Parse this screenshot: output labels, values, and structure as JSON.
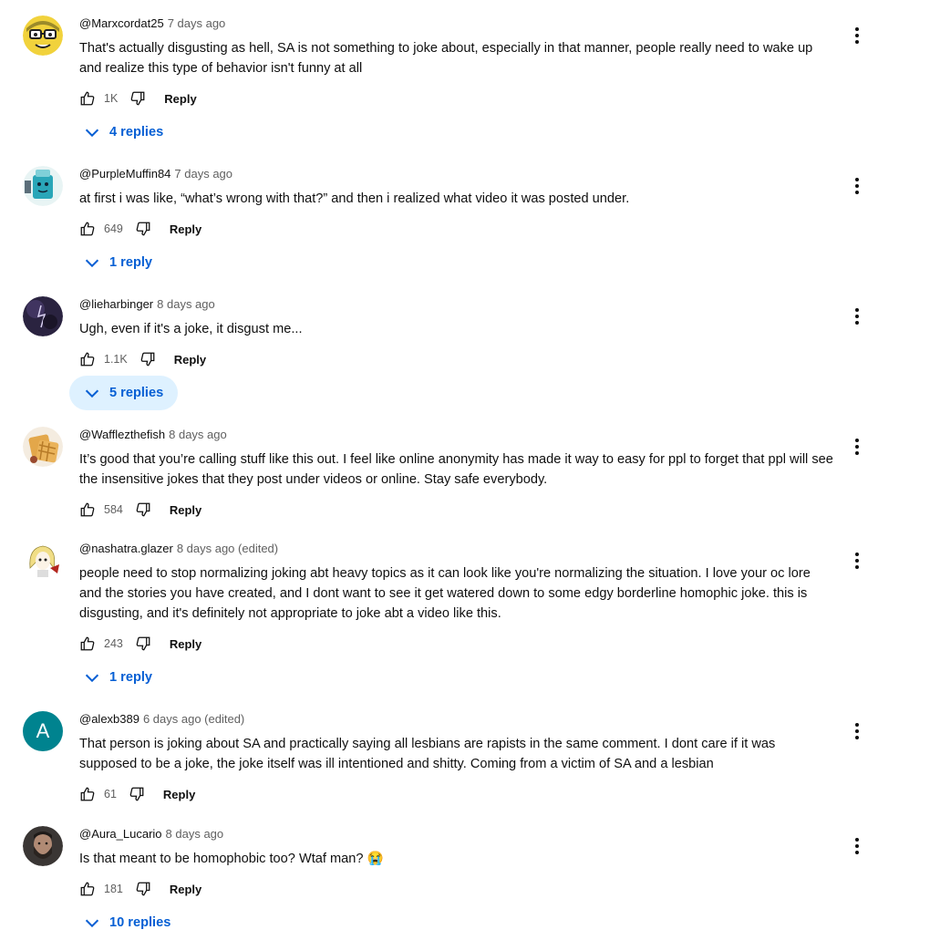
{
  "comments": [
    {
      "handle": "@Marxcordat25",
      "time": "7 days ago",
      "text": "That's actually disgusting as hell, SA is not something to joke about, especially in that manner, people really need to wake up and realize this type of behavior isn't funny at all",
      "likes": "1K",
      "reply_label": "Reply",
      "replies": "4 replies",
      "avatar_icon": "glasses-character-avatar"
    },
    {
      "handle": "@PurpleMuffin84",
      "time": "7 days ago",
      "text": "at first i was like, “what’s wrong with that?” and then i realized what video it was posted under.",
      "likes": "649",
      "reply_label": "Reply",
      "replies": "1 reply",
      "avatar_icon": "teal-character-avatar"
    },
    {
      "handle": "@lieharbinger",
      "time": "8 days ago",
      "text": "Ugh, even if it's a joke, it disgust me...",
      "likes": "1.1K",
      "reply_label": "Reply",
      "replies": "5 replies",
      "avatar_icon": "dark-purple-avatar"
    },
    {
      "handle": "@Wafflezthefish",
      "time": "8 days ago",
      "text": "It’s good that you’re calling stuff like this out. I feel like online anonymity has made it way to easy for ppl to forget that ppl will see the insensitive jokes that they post under videos or online. Stay safe everybody.",
      "likes": "584",
      "reply_label": "Reply",
      "avatar_icon": "waffle-avatar"
    },
    {
      "handle": "@nashatra.glazer",
      "time": "8 days ago (edited)",
      "text": "people need to stop normalizing joking abt heavy topics as it can look like you're normalizing the situation. I love your oc lore and the stories you have created, and I dont want to see it get watered down to some edgy borderline homophic joke. this is disgusting, and it's definitely not appropriate to joke abt a video like this.",
      "likes": "243",
      "reply_label": "Reply",
      "replies": "1 reply",
      "avatar_icon": "blonde-character-avatar"
    },
    {
      "handle": "@alexb389",
      "time": "6 days ago (edited)",
      "text": "That person is joking about SA and practically saying all lesbians are rapists in the same comment.  I dont care if it was supposed to be a joke, the joke itself was ill intentioned and shitty. Coming from a victim of SA and a lesbian",
      "likes": "61",
      "reply_label": "Reply",
      "avatar_letter": "A",
      "avatar_color": "#00838f"
    },
    {
      "handle": "@Aura_Lucario",
      "time": "8 days ago",
      "text": "Is that meant to be homophobic too? Wtaf man? 😭",
      "likes": "181",
      "reply_label": "Reply",
      "replies": "10 replies",
      "avatar_icon": "bearded-man-avatar"
    }
  ],
  "colors": {
    "link_blue": "#065fd4",
    "active_replies_bg": "#def1ff",
    "meta_gray": "#606060"
  }
}
